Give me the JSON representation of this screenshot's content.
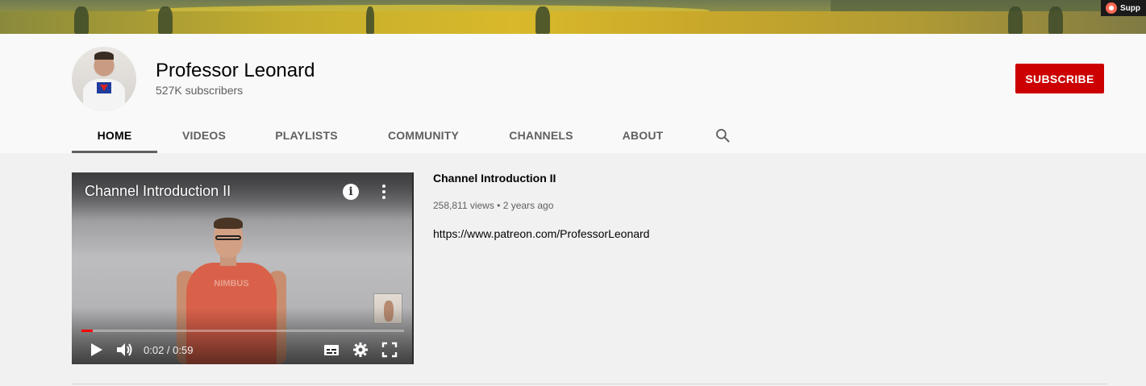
{
  "banner": {
    "support_label": "Supp",
    "support_icon": "patreon-icon"
  },
  "channel": {
    "name": "Professor Leonard",
    "subscribers": "527K subscribers",
    "subscribe_label": "SUBSCRIBE",
    "subscribe_color": "#cc0000"
  },
  "tabs": [
    {
      "label": "HOME",
      "active": true
    },
    {
      "label": "VIDEOS",
      "active": false
    },
    {
      "label": "PLAYLISTS",
      "active": false
    },
    {
      "label": "COMMUNITY",
      "active": false
    },
    {
      "label": "CHANNELS",
      "active": false
    },
    {
      "label": "ABOUT",
      "active": false
    }
  ],
  "search_icon": "search-icon",
  "player": {
    "title": "Channel Introduction II",
    "shirt_print": "NIMBUS",
    "time": "0:02 / 0:59",
    "progress": 0.034,
    "icons": [
      "info-icon",
      "more-icon",
      "play-icon",
      "volume-icon",
      "subtitles-icon",
      "settings-icon",
      "fullscreen-icon"
    ]
  },
  "video_info": {
    "title": "Channel Introduction II",
    "meta": "258,811 views • 2 years ago",
    "description": "https://www.patreon.com/ProfessorLeonard"
  }
}
